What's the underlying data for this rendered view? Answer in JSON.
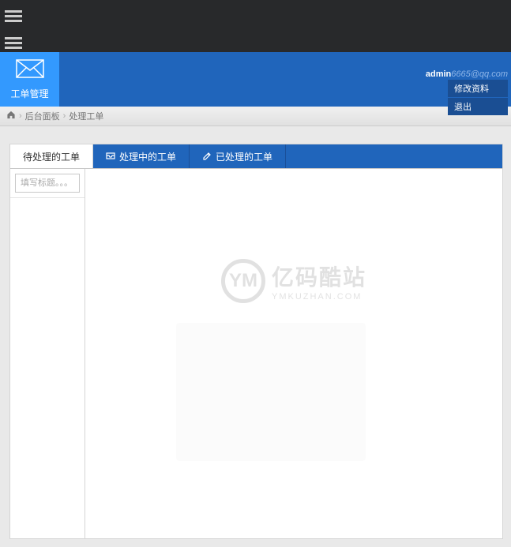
{
  "module": {
    "label": "工单管理"
  },
  "user": {
    "name": "admin",
    "email": "6665@qq.com"
  },
  "user_menu": {
    "edit": "修改资料",
    "logout": "退出"
  },
  "breadcrumb": {
    "home_label": "后台面板",
    "current": "处理工单"
  },
  "tabs": {
    "pending": "待处理的工单",
    "processing": "处理中的工单",
    "done": "已处理的工单"
  },
  "sidebar": {
    "search_placeholder": "填写标题。。。"
  },
  "watermark": {
    "logo_text": "YM",
    "main": "亿码酷站",
    "sub": "YMKUZHAN.COM"
  }
}
